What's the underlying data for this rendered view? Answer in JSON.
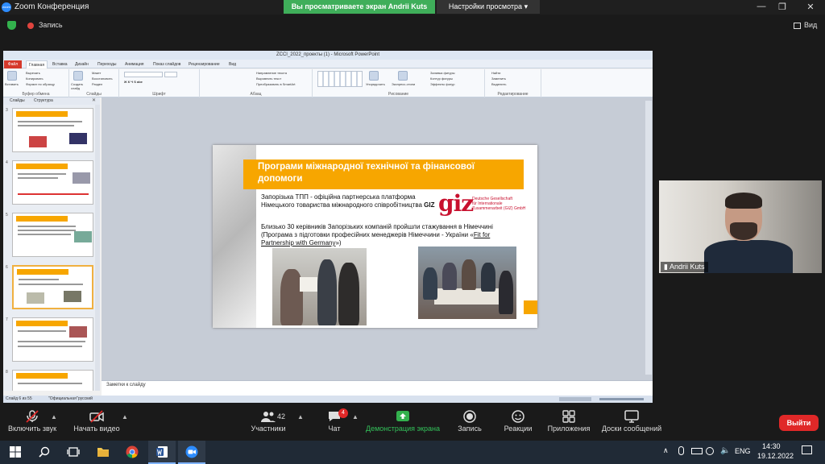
{
  "window": {
    "app_title": "Zoom Конференция",
    "logo_text": "zoom",
    "share_banner": "Вы просматриваете экран Andrii Kuts",
    "view_options": "Настройки просмотра",
    "minimize": "—",
    "maximize": "❐",
    "close": "✕"
  },
  "topbar": {
    "recording": "Запись",
    "view": "Вид"
  },
  "ppt": {
    "title": "ZCCI_2022_проекты (1) - Microsoft PowerPoint",
    "tabs": [
      "Файл",
      "Главная",
      "Вставка",
      "Дизайн",
      "Переходы",
      "Анимация",
      "Показ слайдов",
      "Рецензирование",
      "Вид"
    ],
    "ribbon": {
      "paste": "Вставить",
      "cut": "Вырезать",
      "copy": "Копировать",
      "format_painter": "Формат по образцу",
      "clipboard": "Буфер обмена",
      "create_slide": "Создать слайд",
      "layout": "Макет",
      "reset": "Восстановить",
      "section": "Раздел",
      "slides": "Слайды",
      "font": "Шрифт",
      "text_direction": "Направление текста",
      "align_text": "Выровнять текст",
      "convert_smartart": "Преобразовать в SmartArt",
      "paragraph": "Абзац",
      "arrange": "Упорядочить",
      "quick_styles": "Экспресс-стили",
      "shape_fill": "Заливка фигуры",
      "shape_outline": "Контур фигуры",
      "shape_effects": "Эффекты фигур",
      "drawing": "Рисование",
      "find": "Найти",
      "replace": "Заменить",
      "select": "Выделить",
      "editing": "Редактирование"
    },
    "pane_tabs": [
      "Слайды",
      "Структура"
    ],
    "thumb_numbers": [
      "3",
      "4",
      "5",
      "6",
      "7",
      "8"
    ],
    "notes_placeholder": "Заметки к слайду",
    "status": {
      "slide": "Слайд 6 из 55",
      "theme": "\"Официальная\"",
      "lang": "русский"
    }
  },
  "slide": {
    "title": "Програми міжнародної технічної та фінансової допомоги",
    "para1_pre": "Запорізька ТПП - офіційна партнерська платформа Німецького товариства міжнародного співробітництва ",
    "para1_bold": "GIZ",
    "giz_logo": "giz",
    "giz_line1": "Deutsche Gesellschaft",
    "giz_line2": "für Internationale",
    "giz_line3": "Zusammenarbeit (GIZ) GmbH",
    "para2_pre": "Близько 30 керівників Запорізьких компаній пройшли стажування в Німеччині (Програма з підготовки професійних менеджерів Німеччини - України «",
    "para2_link": "Fit for Partnership with Germany",
    "para2_post": "»)"
  },
  "video": {
    "participant_name": "Andrii Kuts"
  },
  "controls": {
    "mute": "Включить звук",
    "video": "Начать видео",
    "participants": "Участники",
    "participants_count": "42",
    "chat": "Чат",
    "chat_badge": "4",
    "share": "Демонстрация экрана",
    "record": "Запись",
    "reactions": "Реакции",
    "apps": "Приложения",
    "whiteboards": "Доски сообщений",
    "leave": "Выйти"
  },
  "taskbar": {
    "lang": "ENG",
    "time": "14:30",
    "date": "19.12.2022"
  },
  "colors": {
    "accent_orange": "#f7a600",
    "zoom_green": "#3fae5a",
    "leave_red": "#e02828",
    "giz_red": "#c8102e"
  }
}
